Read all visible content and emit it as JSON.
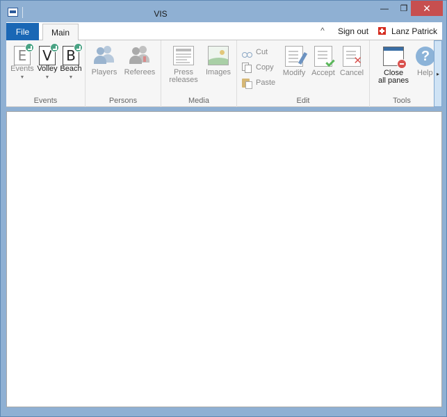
{
  "window": {
    "title": "VIS",
    "min_glyph": "—",
    "max_glyph": "❐",
    "close_glyph": "✕"
  },
  "tabs": {
    "file": "File",
    "main": "Main"
  },
  "header": {
    "collapse_glyph": "^",
    "sign_out": "Sign out",
    "user_name": "Lanz Patrick"
  },
  "ribbon": {
    "events_group": {
      "label": "Events",
      "buttons": [
        {
          "letter": "E",
          "label": "Events"
        },
        {
          "letter": "V",
          "label": "Volley"
        },
        {
          "letter": "B",
          "label": "Beach"
        }
      ]
    },
    "persons_group": {
      "label": "Persons",
      "players": "Players",
      "referees": "Referees"
    },
    "media_group": {
      "label": "Media",
      "press_line1": "Press",
      "press_line2": "releases",
      "images": "Images"
    },
    "edit_group": {
      "label": "Edit",
      "cut": "Cut",
      "copy": "Copy",
      "paste": "Paste",
      "modify": "Modify",
      "accept": "Accept",
      "cancel": "Cancel"
    },
    "tools_group": {
      "label": "Tools",
      "close_line1": "Close",
      "close_line2": "all panes",
      "help": "Help"
    },
    "scroll_glyph": "▸"
  },
  "colors": {
    "titlebar": "#8fb0d3",
    "file_tab": "#1a67b5",
    "close_button": "#c74f4f",
    "badge": "#4aa384"
  }
}
